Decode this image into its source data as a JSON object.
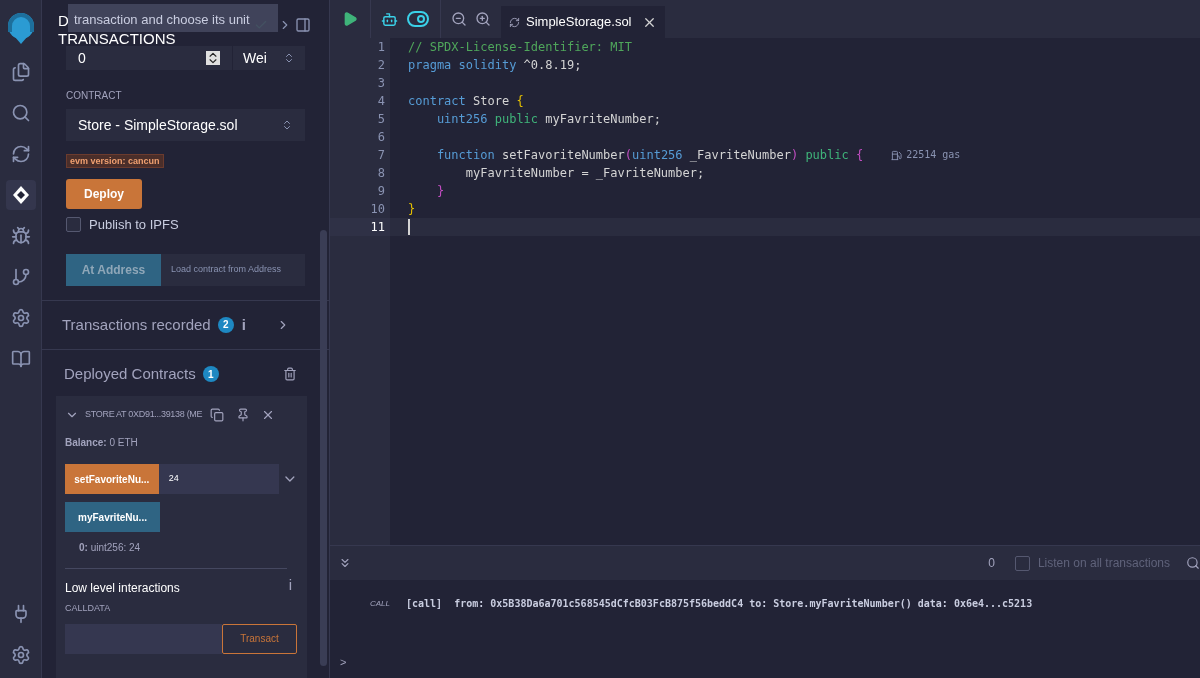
{
  "activity_bar": {
    "items": [
      {
        "selected": false
      },
      {
        "selected": false
      },
      {
        "selected": false
      },
      {
        "selected": true
      },
      {
        "selected": false
      },
      {
        "selected": false
      },
      {
        "selected": false
      },
      {
        "selected": false
      }
    ]
  },
  "sidebar": {
    "title_lines": [
      "D",
      "TRANSACTIONS"
    ],
    "tooltip": "transaction and choose its unit",
    "value": {
      "value": "0",
      "unit": "Wei"
    },
    "contract_label": "CONTRACT",
    "contract": "Store - SimpleStorage.sol",
    "evm_badge": "evm version: cancun",
    "deploy_button": "Deploy",
    "publish": {
      "label": "Publish to IPFS",
      "checked": false
    },
    "at_address_button": "At Address",
    "address_placeholder": "Load contract from Address",
    "transactions_recorded": {
      "label": "Transactions recorded",
      "count": "2",
      "info": "i"
    },
    "deployed": {
      "label": "Deployed Contracts",
      "count": "1",
      "instance": {
        "title": "STORE AT 0XD91...39138 (ME",
        "expanded": true,
        "balance_label": "Balance:",
        "balance": "0 ETH",
        "functions": [
          {
            "kind": "transact",
            "name": "setFavoriteNu...",
            "value": "24"
          },
          {
            "kind": "call",
            "name": "myFavriteNu..."
          }
        ],
        "result": {
          "key": "0:",
          "value": "uint256: 24"
        },
        "low_level": {
          "title": "Low level interactions",
          "info": "i",
          "calldata_label": "CALLDATA",
          "button": "Transact"
        }
      }
    }
  },
  "editor": {
    "tabs": [
      {
        "label": "SimpleStorage.sol",
        "selected": true
      }
    ],
    "lines": [
      {
        "n": "1",
        "tokens": [
          {
            "kind": "comment",
            "text": "// SPDX-License-Identifier: MIT"
          }
        ]
      },
      {
        "n": "2",
        "tokens": [
          {
            "kind": "keyword",
            "text": "pragma solidity "
          },
          {
            "kind": "plain",
            "text": "^0.8.19;"
          }
        ]
      },
      {
        "n": "3"
      },
      {
        "n": "4",
        "tokens": [
          {
            "kind": "keyword",
            "text": "contract "
          },
          {
            "kind": "plain",
            "text": "Store "
          },
          {
            "kind": "brace1",
            "text": "{"
          }
        ]
      },
      {
        "n": "5",
        "tokens": [
          {
            "kind": "keyword",
            "text": "    uint256 "
          },
          {
            "kind": "modifier",
            "text": "public "
          },
          {
            "kind": "plain",
            "text": "myFavriteNumber;"
          }
        ]
      },
      {
        "n": "6"
      },
      {
        "n": "7",
        "tokens": [
          {
            "kind": "keyword",
            "text": "    function "
          },
          {
            "kind": "plain",
            "text": "setFavoriteNumber"
          },
          {
            "kind": "brace2",
            "text": "("
          },
          {
            "kind": "keyword",
            "text": "uint256 "
          },
          {
            "kind": "plain",
            "text": "_FavriteNumber"
          },
          {
            "kind": "brace2",
            "text": ")"
          },
          {
            "kind": "modifier",
            "text": " public "
          },
          {
            "kind": "brace2",
            "text": "{"
          }
        ],
        "gas": "22514 gas"
      },
      {
        "n": "8",
        "tokens": [
          {
            "kind": "plain",
            "text": "        myFavriteNumber = _FavriteNumber;"
          }
        ]
      },
      {
        "n": "9",
        "tokens": [
          {
            "kind": "brace2",
            "text": "    }"
          }
        ]
      },
      {
        "n": "10",
        "tokens": [
          {
            "kind": "brace1",
            "text": "}"
          }
        ]
      },
      {
        "n": "11",
        "current": true
      }
    ]
  },
  "terminal": {
    "count": "0",
    "listen": {
      "label": "Listen on all transactions",
      "checked": false
    },
    "logs": [
      {
        "tag": "CALL",
        "text": "[call]  from: 0x5B38Da6a701c568545dCfcB03FcB875f56beddC4 to: Store.myFavriteNumber() data: 0x6e4...c5213"
      }
    ],
    "prompt": ">"
  }
}
